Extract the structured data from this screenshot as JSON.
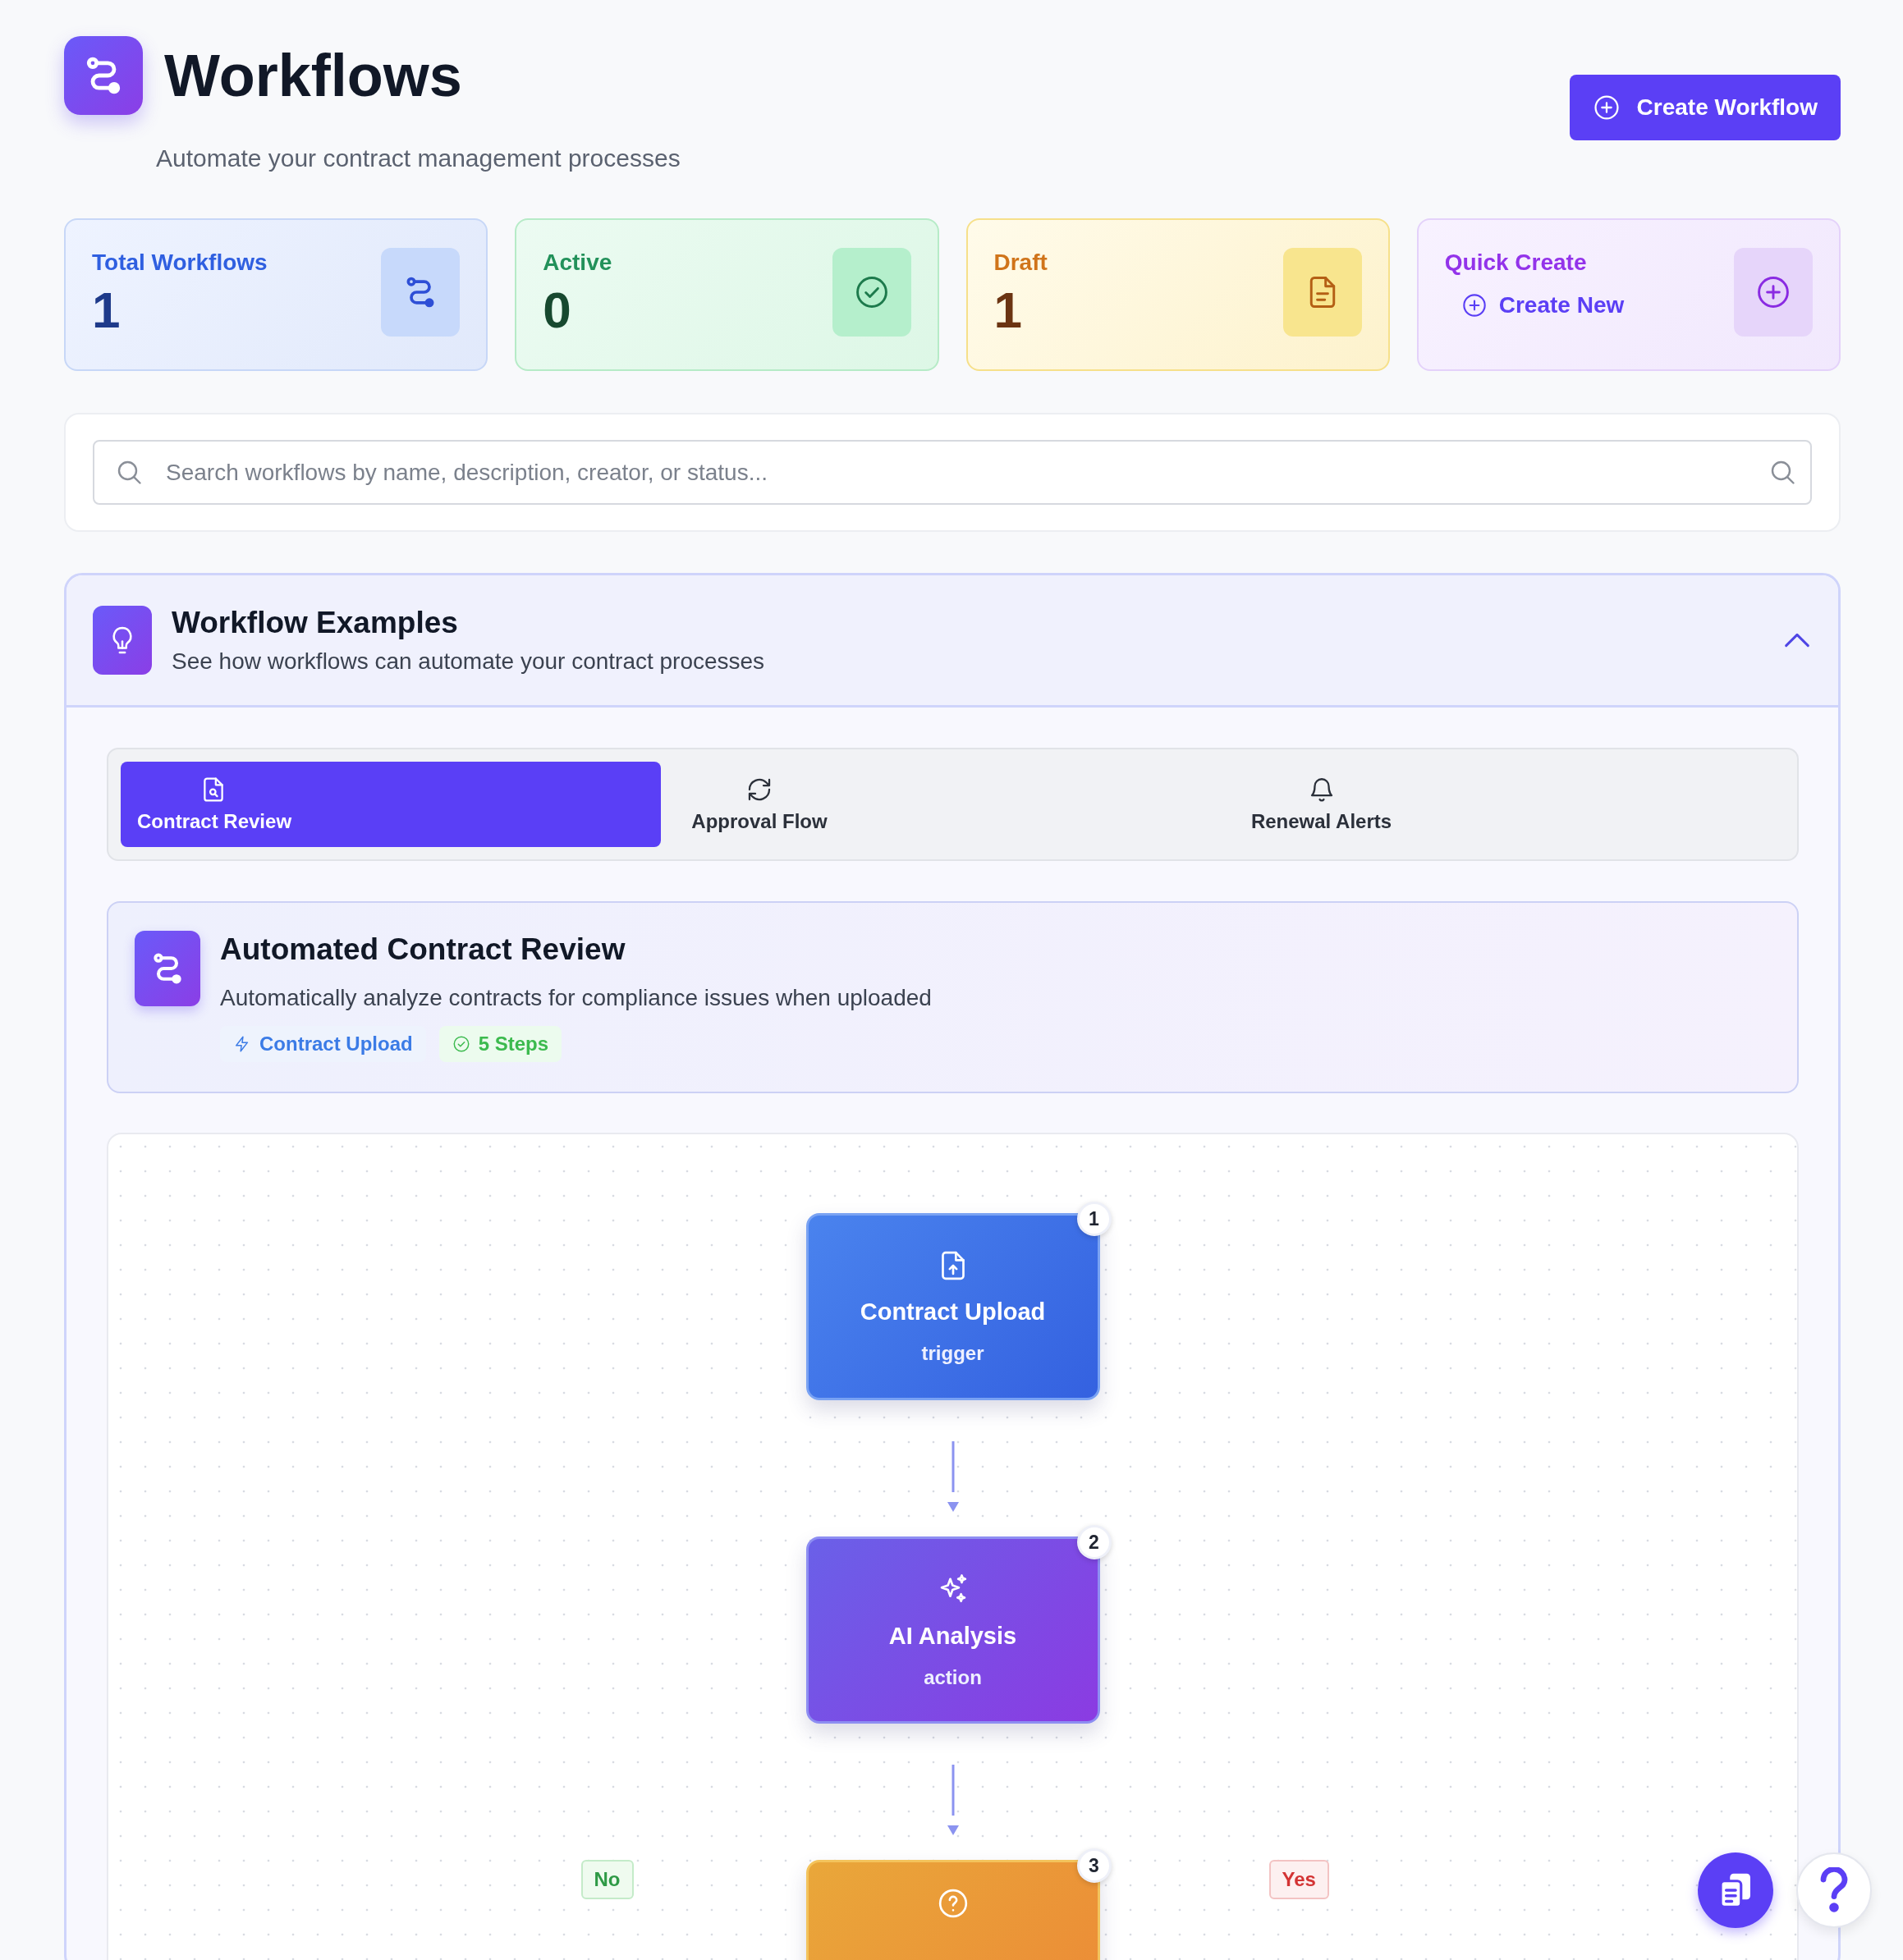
{
  "header": {
    "title": "Workflows",
    "subtitle": "Automate your contract management processes",
    "create_button": "Create Workflow"
  },
  "stats": [
    {
      "kind": "total",
      "label": "Total Workflows",
      "value": "1"
    },
    {
      "kind": "active",
      "label": "Active",
      "value": "0"
    },
    {
      "kind": "draft",
      "label": "Draft",
      "value": "1"
    },
    {
      "kind": "quick",
      "label": "Quick Create",
      "link": "Create New"
    }
  ],
  "search": {
    "placeholder": "Search workflows by name, description, creator, or status..."
  },
  "examples": {
    "title": "Workflow Examples",
    "subtitle": "See how workflows can automate your contract processes",
    "expanded": true,
    "tabs": [
      {
        "kind": "review",
        "label": "Contract Review",
        "selected": true
      },
      {
        "kind": "approval",
        "label": "Approval Flow",
        "selected": false
      },
      {
        "kind": "renewal",
        "label": "Renewal Alerts",
        "selected": false
      }
    ],
    "example": {
      "title": "Automated Contract Review",
      "description": "Automatically analyze contracts for compliance issues when uploaded",
      "trigger": "Contract Upload",
      "steps": "5 Steps"
    },
    "nodes": [
      {
        "kind": "trigger",
        "number": "1",
        "title": "Contract Upload",
        "type": "trigger"
      },
      {
        "kind": "action",
        "number": "2",
        "title": "AI Analysis",
        "type": "action"
      },
      {
        "kind": "condition",
        "number": "3"
      }
    ],
    "branches": [
      {
        "kind": "no",
        "label": "No"
      },
      {
        "kind": "yes",
        "label": "Yes"
      }
    ]
  }
}
